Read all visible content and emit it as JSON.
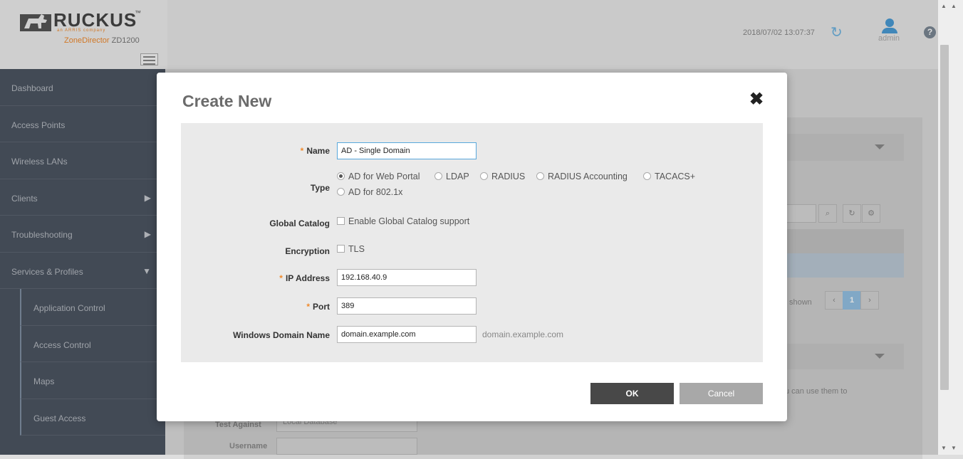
{
  "header": {
    "brand": "RUCKUS",
    "brand_tm": "™",
    "brand_sub": "an ARRIS company",
    "product_name": "ZoneDirector",
    "product_model": "ZD1200",
    "datetime": "2018/07/02  13:07:37",
    "user": "admin"
  },
  "sidebar": {
    "items": [
      {
        "label": "Dashboard"
      },
      {
        "label": "Access Points"
      },
      {
        "label": "Wireless LANs"
      },
      {
        "label": "Clients",
        "arrow": "▶"
      },
      {
        "label": "Troubleshooting",
        "arrow": "▶"
      },
      {
        "label": "Services & Profiles",
        "arrow": "▼"
      }
    ],
    "subitems": [
      {
        "label": "Application Control"
      },
      {
        "label": "Access Control"
      },
      {
        "label": "Maps"
      },
      {
        "label": "Guest Access"
      }
    ]
  },
  "background": {
    "shown_text": "shown",
    "page_number": "1",
    "prev": "‹",
    "next": "›",
    "hint_text": "u can use them to",
    "test_against_label": "Test Against",
    "test_against_value": "Local Database",
    "username_label": "Username"
  },
  "modal": {
    "title": "Create New",
    "close_glyph": "✖",
    "fields": {
      "name_label": "Name",
      "name_value": "AD - Single Domain",
      "type_label": "Type",
      "type_options": [
        "AD for Web Portal",
        "LDAP",
        "RADIUS",
        "RADIUS Accounting",
        "TACACS+",
        "AD for 802.1x"
      ],
      "type_selected": "AD for Web Portal",
      "global_catalog_label": "Global Catalog",
      "global_catalog_option": "Enable Global Catalog support",
      "encryption_label": "Encryption",
      "encryption_option": "TLS",
      "ip_label": "IP Address",
      "ip_value": "192.168.40.9",
      "port_label": "Port",
      "port_value": "389",
      "domain_label": "Windows Domain Name",
      "domain_value": "domain.example.com",
      "domain_hint": "domain.example.com"
    },
    "ok_label": "OK",
    "cancel_label": "Cancel"
  },
  "colors": {
    "accent_orange": "#f08a2b",
    "sidebar_bg": "#4c5562",
    "ok_button": "#484848",
    "cancel_button": "#a8a8a8"
  }
}
